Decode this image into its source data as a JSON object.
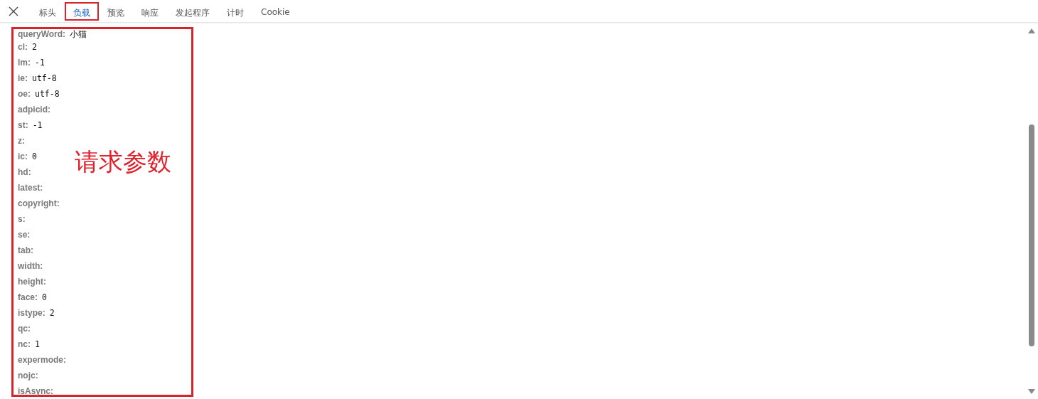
{
  "tabs": [
    {
      "label": "标头",
      "selected": false,
      "annotated": false
    },
    {
      "label": "负载",
      "selected": true,
      "annotated": true
    },
    {
      "label": "预览",
      "selected": false,
      "annotated": false
    },
    {
      "label": "响应",
      "selected": false,
      "annotated": false
    },
    {
      "label": "发起程序",
      "selected": false,
      "annotated": false
    },
    {
      "label": "计时",
      "selected": false,
      "annotated": false
    },
    {
      "label": "Cookie",
      "selected": false,
      "annotated": false
    }
  ],
  "payload": {
    "annotated": true,
    "annotation_label": "请求参数",
    "params": [
      {
        "key": "queryWord:",
        "value": "小猫"
      },
      {
        "key": "cl:",
        "value": "2"
      },
      {
        "key": "lm:",
        "value": "-1"
      },
      {
        "key": "ie:",
        "value": "utf-8"
      },
      {
        "key": "oe:",
        "value": "utf-8"
      },
      {
        "key": "adpicid:"
      },
      {
        "key": "st:",
        "value": "-1"
      },
      {
        "key": "z:"
      },
      {
        "key": "ic:",
        "value": "0"
      },
      {
        "key": "hd:"
      },
      {
        "key": "latest:"
      },
      {
        "key": "copyright:"
      },
      {
        "key": "s:"
      },
      {
        "key": "se:"
      },
      {
        "key": "tab:"
      },
      {
        "key": "width:"
      },
      {
        "key": "height:"
      },
      {
        "key": "face:",
        "value": "0"
      },
      {
        "key": "istype:",
        "value": "2"
      },
      {
        "key": "qc:"
      },
      {
        "key": "nc:",
        "value": "1"
      },
      {
        "key": "expermode:"
      },
      {
        "key": "nojc:"
      },
      {
        "key": "isAsync:"
      }
    ]
  }
}
